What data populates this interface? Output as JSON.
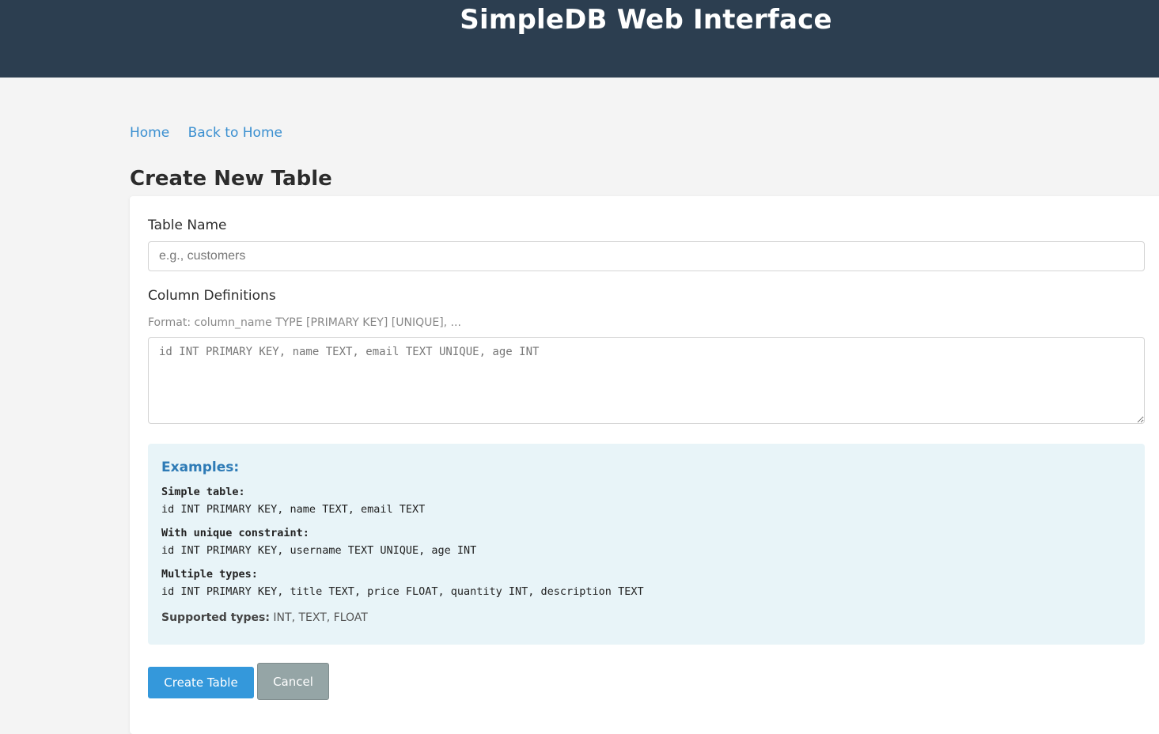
{
  "header": {
    "title": "SimpleDB Web Interface"
  },
  "nav": {
    "links": [
      "Home",
      "Back to Home"
    ]
  },
  "page_title": "Create New Table",
  "form": {
    "table_name_label": "Table Name",
    "table_name_placeholder": "e.g., customers",
    "table_name_value": "",
    "columns_label": "Column Definitions",
    "columns_hint": "Format: column_name TYPE [PRIMARY KEY] [UNIQUE], ...",
    "columns_placeholder": "id INT PRIMARY KEY, name TEXT, email TEXT UNIQUE, age INT",
    "columns_value": ""
  },
  "examples": {
    "heading": "Examples:",
    "items": [
      {
        "title": "Simple table:",
        "code": "id INT PRIMARY KEY, name TEXT, email TEXT"
      },
      {
        "title": "With unique constraint:",
        "code": "id INT PRIMARY KEY, username TEXT UNIQUE, age INT"
      },
      {
        "title": "Multiple types:",
        "code": "id INT PRIMARY KEY, title TEXT, price FLOAT, quantity INT, description TEXT"
      }
    ],
    "supported_label": "Supported types:",
    "supported_value": "INT, TEXT, FLOAT"
  },
  "buttons": {
    "create": "Create Table",
    "cancel": "Cancel"
  },
  "colors": {
    "header_bg": "#2c3e50",
    "link": "#3a8fd0",
    "primary": "#3498db",
    "cancel": "#95a5a6",
    "examples_bg": "#e8f4f8",
    "examples_heading": "#2e7bb6"
  }
}
